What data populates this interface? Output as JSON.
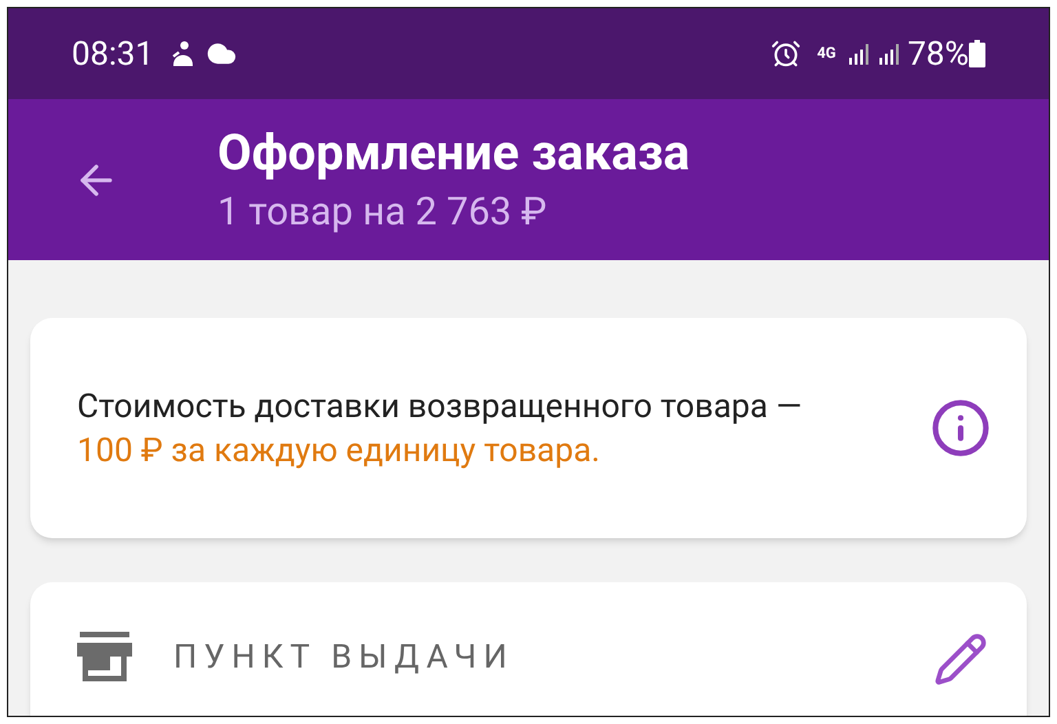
{
  "status_bar": {
    "time": "08:31",
    "network": "4G",
    "battery": "78%"
  },
  "app_bar": {
    "title": "Оформление заказа",
    "subtitle": "1 товар на 2 763 ₽"
  },
  "notice": {
    "text": "Стоимость доставки возвращенного товара —",
    "highlight": "100 ₽ за каждую единицу товара."
  },
  "section": {
    "title": "ПУНКТ ВЫДАЧИ"
  }
}
